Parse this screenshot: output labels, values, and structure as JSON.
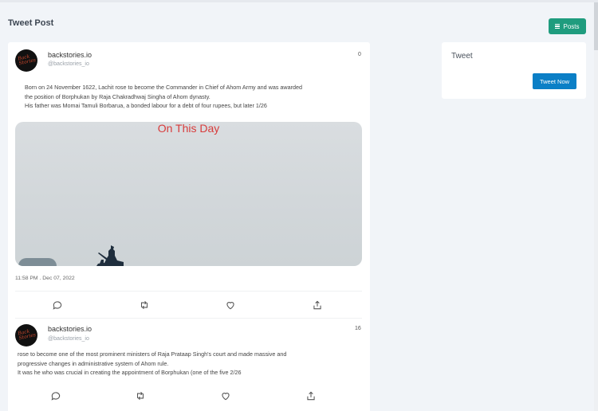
{
  "header": {
    "title": "Tweet Post",
    "posts_button": "Posts"
  },
  "sidebar_card": {
    "title": "Tweet",
    "button": "Tweet Now"
  },
  "tweets": [
    {
      "name": "backstories.io",
      "handle": "@backstories_io",
      "count": "0",
      "lines": [
        "Born on 24 November 1622, Lachit rose to become the Commander in Chief of Ahom Army and was awarded",
        "the position of Borphukan by Raja Chakradhwaj Singha of Ahom dynasty.",
        "His father was Momai Tamuli Borbarua, a bonded labour for a debt of four rupees, but later 1/26"
      ],
      "media_title": "On This Day",
      "timestamp": "11:58 PM . Dec 07, 2022"
    },
    {
      "name": "backstories.io",
      "handle": "@backstories_io",
      "count": "16",
      "lines": [
        "rose to become one of the most prominent ministers of Raja Prataap Singh's court and made massive and",
        "progressive changes in administrative system of Ahom rule.",
        "It was he who was crucial in creating the appointment of Borphukan (one of the five 2/26"
      ]
    }
  ],
  "avatar_text": "Back Stories",
  "icons": [
    "bars-icon",
    "comment-icon",
    "retweet-icon",
    "heart-icon",
    "share-icon"
  ],
  "colors": {
    "posts_button": "#1f9c7e",
    "tweet_now_button": "#0b7fc6",
    "media_title": "#d83b3b"
  }
}
